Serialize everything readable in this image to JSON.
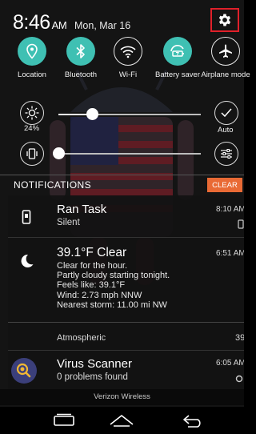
{
  "status_bar": {
    "time": "8:46",
    "ampm": "AM",
    "date": "Mon, Mar 16"
  },
  "quick_toggles": [
    {
      "label": "Location",
      "icon": "location-icon",
      "state": "on"
    },
    {
      "label": "Bluetooth",
      "icon": "bluetooth-icon",
      "state": "on"
    },
    {
      "label": "Wi-Fi",
      "icon": "wifi-icon",
      "state": "off"
    },
    {
      "label": "Battery saver",
      "icon": "battery-saver-icon",
      "state": "on"
    },
    {
      "label": "Airplane mode",
      "icon": "airplane-icon",
      "state": "off"
    }
  ],
  "brightness": {
    "value_label": "24%",
    "level": 0.24,
    "auto_label": "Auto"
  },
  "volume": {
    "level": 0.0
  },
  "notifications": {
    "header": "NOTIFICATIONS",
    "clear_label": "CLEAR",
    "items": [
      {
        "title": "Ran Task",
        "subtitle": "Silent",
        "time": "8:10 AM"
      },
      {
        "title": "39.1°F Clear",
        "time": "6:51 AM",
        "lines": [
          "Clear for the hour.",
          "Partly cloudy starting tonight.",
          "Feels like: 39.1°F",
          "Wind: 2.73 mph NNW",
          "Nearest storm: 11.00 mi NW"
        ],
        "footer": "Atmospheric",
        "footer_value": "39"
      },
      {
        "title": "Virus Scanner",
        "subtitle": "0 problems found",
        "time": "6:05 AM"
      }
    ]
  },
  "carrier": "Verizon Wireless",
  "colors": {
    "accent": "#3fc0b3",
    "clear_button": "#e96a35",
    "highlight_box": "#e0202a"
  }
}
